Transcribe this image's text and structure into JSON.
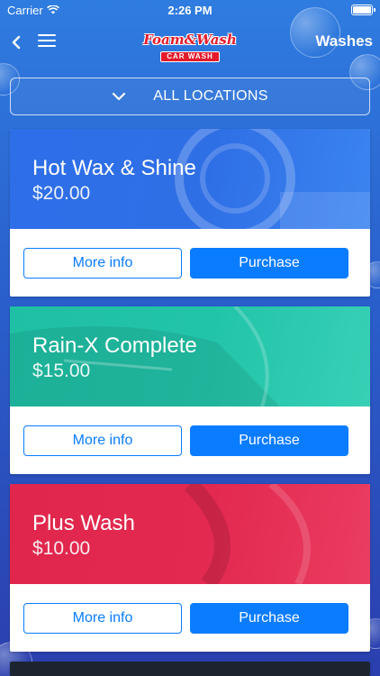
{
  "status_bar": {
    "carrier": "Carrier",
    "time": "2:26 PM"
  },
  "nav": {
    "logo_line1": "Foam&Wash",
    "logo_line2": "CAR WASH",
    "title": "Washes"
  },
  "location_selector": {
    "label": "ALL LOCATIONS"
  },
  "washes": [
    {
      "name": "Hot Wax & Shine",
      "price": "$20.00",
      "color": "#2f6fe6",
      "more_info": "More info",
      "purchase": "Purchase"
    },
    {
      "name": "Rain-X Complete",
      "price": "$15.00",
      "color": "#21c3a8",
      "more_info": "More info",
      "purchase": "Purchase"
    },
    {
      "name": "Plus Wash",
      "price": "$10.00",
      "color": "#e3294f",
      "more_info": "More info",
      "purchase": "Purchase"
    }
  ],
  "colors": {
    "accent": "#0a7cff",
    "logo_red": "#e51b2b"
  }
}
